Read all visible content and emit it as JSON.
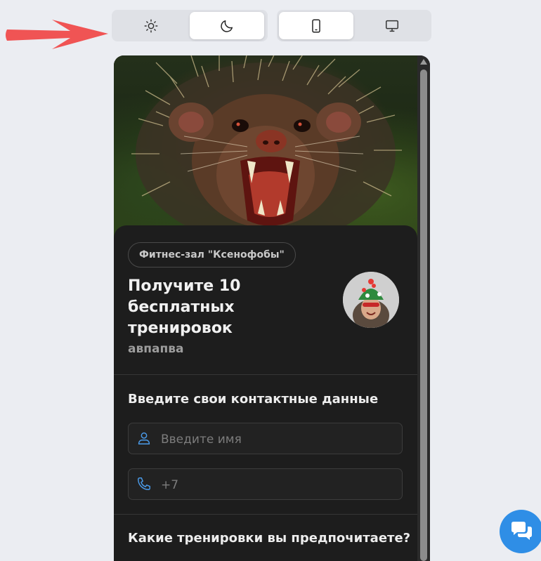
{
  "toolbar": {
    "theme": {
      "light_icon": "sun-icon",
      "dark_icon": "moon-icon",
      "selected": "dark"
    },
    "device": {
      "mobile_icon": "phone-icon",
      "desktop_icon": "monitor-icon",
      "selected": "mobile"
    }
  },
  "annotation": {
    "arrow_color": "#f05454"
  },
  "card": {
    "badge": "Фитнес-зал \"Ксенофобы\"",
    "title": "Получите 10 бесплатных тренировок",
    "subtitle": "авпапва",
    "avatar_icon": "avatar"
  },
  "contact": {
    "heading": "Введите свои контактные данные",
    "name_placeholder": "Введите имя",
    "phone_placeholder": "+7"
  },
  "question": {
    "heading": "Какие тренировки вы предпочитаете?"
  },
  "colors": {
    "accent": "#2f8ee6",
    "card_bg": "#1d1d1d",
    "page_bg": "#ebedf2"
  },
  "chat_icon": "chat-bubbles-icon"
}
